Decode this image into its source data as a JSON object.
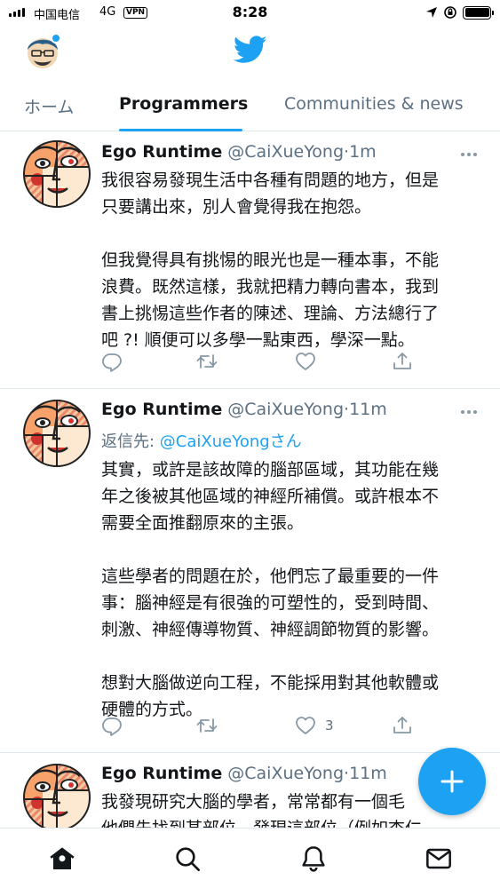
{
  "status_bar": {
    "carrier": "中国电信",
    "network": "4G",
    "vpn": "VPN",
    "time": "8:28"
  },
  "header": {
    "profile_icon": "profile-avatar",
    "logo_icon": "twitter-bird-icon",
    "brand_color": "#1da1f2"
  },
  "tabs": [
    {
      "label": "ホーム",
      "active": false
    },
    {
      "label": "Programmers",
      "active": true
    },
    {
      "label": "Communities & news",
      "active": false
    }
  ],
  "tweets": [
    {
      "name": "Ego Runtime",
      "handle": "@CaiXueYong",
      "dot": "·",
      "time": "1m",
      "lines": [
        "我很容易發現生活中各種有問題的地方，但是",
        "只要講出來，別人會覺得我在抱怨。",
        "",
        "但我覺得具有挑惕的眼光也是一種本事，不能",
        "浪費。既然這樣，我就把精力轉向書本，我到",
        "書上挑惕這些作者的陳述、理論、方法總行了",
        "吧 ?! 順便可以多學一點東西，學深一點。"
      ],
      "like_count": ""
    },
    {
      "name": "Ego Runtime",
      "handle": "@CaiXueYong",
      "dot": "·",
      "time": "11m",
      "reply_prefix": "返信先: ",
      "reply_mention": "@CaiXueYongさん",
      "lines": [
        "其實，或許是該故障的腦部區域，其功能在幾",
        "年之後被其他區域的神經所補償。或許根本不",
        "需要全面推翻原來的主張。",
        "",
        "這些學者的問題在於，他們忘了最重要的一件",
        "事：腦神經是有很強的可塑性的，受到時間、",
        "刺激、神經傳導物質、神經調節物質的影響。",
        "",
        "想對大腦做逆向工程，不能採用對其他軟體或",
        "硬體的方式。"
      ],
      "like_count": "3"
    },
    {
      "name": "Ego Runtime",
      "handle": "@CaiXueYong",
      "dot": "·",
      "time": "11m",
      "lines": [
        "我發現研究大腦的學者，常常都有一個毛",
        "他們先找到某部位，發現這部位（例如杏仁"
      ],
      "like_count": ""
    }
  ],
  "fab": {
    "icon": "compose-plus-icon"
  },
  "bottom_nav": [
    {
      "icon": "home-icon",
      "active": true
    },
    {
      "icon": "search-icon",
      "active": false
    },
    {
      "icon": "notifications-bell-icon",
      "active": false
    },
    {
      "icon": "messages-envelope-icon",
      "active": false
    }
  ]
}
